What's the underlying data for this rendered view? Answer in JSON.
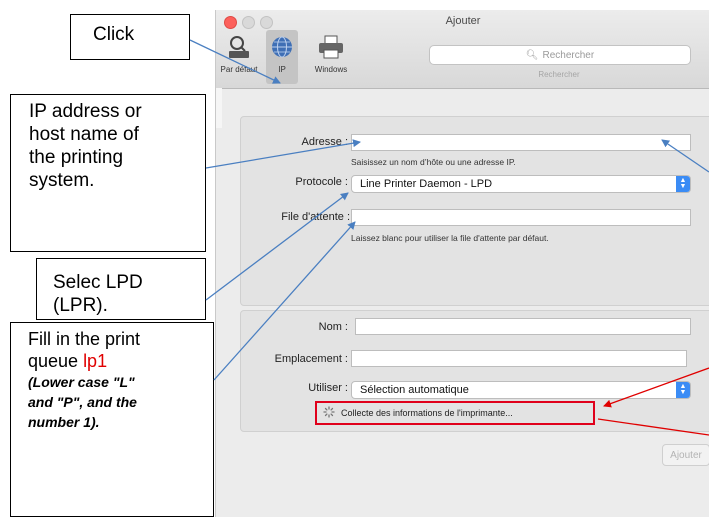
{
  "window": {
    "title": "Ajouter",
    "toolbar": [
      {
        "label": "Par défaut",
        "icon": "magnifier-printer-icon"
      },
      {
        "label": "IP",
        "icon": "globe-icon"
      },
      {
        "label": "Windows",
        "icon": "printer-icon"
      }
    ],
    "search": {
      "placeholder": "Rechercher",
      "caption": "Rechercher"
    },
    "form": {
      "address_label": "Adresse :",
      "address_value": "",
      "address_hint": "Saisissez un nom d’hôte ou une adresse IP.",
      "protocol_label": "Protocole :",
      "protocol_value": "Line Printer Daemon - LPD",
      "queue_label": "File d'attente :",
      "queue_value": "",
      "queue_hint": "Laissez blanc pour utiliser la file d'attente par défaut.",
      "name_label": "Nom :",
      "name_value": "",
      "location_label": "Emplacement :",
      "location_value": "",
      "use_label": "Utiliser :",
      "use_value": "Sélection automatique"
    },
    "status_text": "Collecte des informations de l'imprimante...",
    "add_button": "Ajouter"
  },
  "annotations": {
    "click": "Click",
    "ip": [
      "IP address or",
      "host name of",
      "the printing",
      "system."
    ],
    "lpd": [
      "Selec LPD",
      "(LPR)."
    ],
    "fill": {
      "line1": "Fill in the print",
      "line2_prefix": "queue ",
      "queue_name": "lp1",
      "note": [
        "(Lower case \"L\"",
        "and \"P\", and the",
        "number 1)."
      ]
    }
  },
  "colors": {
    "arrow_blue": "#4a7fc1",
    "arrow_red": "#e00000",
    "highlight_red": "#e0001b",
    "select_blue": "#3b8cf5"
  }
}
